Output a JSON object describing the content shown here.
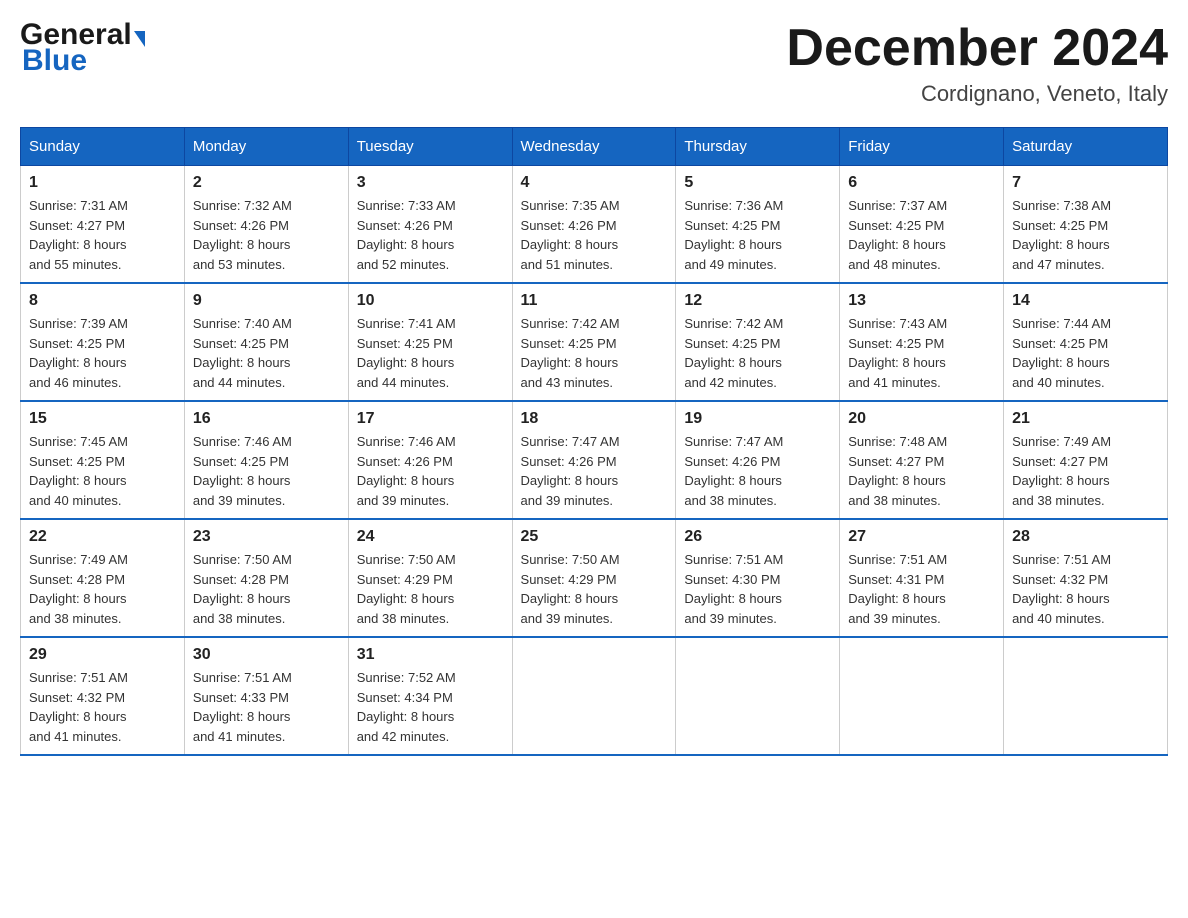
{
  "header": {
    "logo_general": "General",
    "logo_blue": "Blue",
    "month_title": "December 2024",
    "location": "Cordignano, Veneto, Italy"
  },
  "days_of_week": [
    "Sunday",
    "Monday",
    "Tuesday",
    "Wednesday",
    "Thursday",
    "Friday",
    "Saturday"
  ],
  "weeks": [
    [
      {
        "day": "1",
        "sunrise": "7:31 AM",
        "sunset": "4:27 PM",
        "daylight": "8 hours and 55 minutes."
      },
      {
        "day": "2",
        "sunrise": "7:32 AM",
        "sunset": "4:26 PM",
        "daylight": "8 hours and 53 minutes."
      },
      {
        "day": "3",
        "sunrise": "7:33 AM",
        "sunset": "4:26 PM",
        "daylight": "8 hours and 52 minutes."
      },
      {
        "day": "4",
        "sunrise": "7:35 AM",
        "sunset": "4:26 PM",
        "daylight": "8 hours and 51 minutes."
      },
      {
        "day": "5",
        "sunrise": "7:36 AM",
        "sunset": "4:25 PM",
        "daylight": "8 hours and 49 minutes."
      },
      {
        "day": "6",
        "sunrise": "7:37 AM",
        "sunset": "4:25 PM",
        "daylight": "8 hours and 48 minutes."
      },
      {
        "day": "7",
        "sunrise": "7:38 AM",
        "sunset": "4:25 PM",
        "daylight": "8 hours and 47 minutes."
      }
    ],
    [
      {
        "day": "8",
        "sunrise": "7:39 AM",
        "sunset": "4:25 PM",
        "daylight": "8 hours and 46 minutes."
      },
      {
        "day": "9",
        "sunrise": "7:40 AM",
        "sunset": "4:25 PM",
        "daylight": "8 hours and 44 minutes."
      },
      {
        "day": "10",
        "sunrise": "7:41 AM",
        "sunset": "4:25 PM",
        "daylight": "8 hours and 44 minutes."
      },
      {
        "day": "11",
        "sunrise": "7:42 AM",
        "sunset": "4:25 PM",
        "daylight": "8 hours and 43 minutes."
      },
      {
        "day": "12",
        "sunrise": "7:42 AM",
        "sunset": "4:25 PM",
        "daylight": "8 hours and 42 minutes."
      },
      {
        "day": "13",
        "sunrise": "7:43 AM",
        "sunset": "4:25 PM",
        "daylight": "8 hours and 41 minutes."
      },
      {
        "day": "14",
        "sunrise": "7:44 AM",
        "sunset": "4:25 PM",
        "daylight": "8 hours and 40 minutes."
      }
    ],
    [
      {
        "day": "15",
        "sunrise": "7:45 AM",
        "sunset": "4:25 PM",
        "daylight": "8 hours and 40 minutes."
      },
      {
        "day": "16",
        "sunrise": "7:46 AM",
        "sunset": "4:25 PM",
        "daylight": "8 hours and 39 minutes."
      },
      {
        "day": "17",
        "sunrise": "7:46 AM",
        "sunset": "4:26 PM",
        "daylight": "8 hours and 39 minutes."
      },
      {
        "day": "18",
        "sunrise": "7:47 AM",
        "sunset": "4:26 PM",
        "daylight": "8 hours and 39 minutes."
      },
      {
        "day": "19",
        "sunrise": "7:47 AM",
        "sunset": "4:26 PM",
        "daylight": "8 hours and 38 minutes."
      },
      {
        "day": "20",
        "sunrise": "7:48 AM",
        "sunset": "4:27 PM",
        "daylight": "8 hours and 38 minutes."
      },
      {
        "day": "21",
        "sunrise": "7:49 AM",
        "sunset": "4:27 PM",
        "daylight": "8 hours and 38 minutes."
      }
    ],
    [
      {
        "day": "22",
        "sunrise": "7:49 AM",
        "sunset": "4:28 PM",
        "daylight": "8 hours and 38 minutes."
      },
      {
        "day": "23",
        "sunrise": "7:50 AM",
        "sunset": "4:28 PM",
        "daylight": "8 hours and 38 minutes."
      },
      {
        "day": "24",
        "sunrise": "7:50 AM",
        "sunset": "4:29 PM",
        "daylight": "8 hours and 38 minutes."
      },
      {
        "day": "25",
        "sunrise": "7:50 AM",
        "sunset": "4:29 PM",
        "daylight": "8 hours and 39 minutes."
      },
      {
        "day": "26",
        "sunrise": "7:51 AM",
        "sunset": "4:30 PM",
        "daylight": "8 hours and 39 minutes."
      },
      {
        "day": "27",
        "sunrise": "7:51 AM",
        "sunset": "4:31 PM",
        "daylight": "8 hours and 39 minutes."
      },
      {
        "day": "28",
        "sunrise": "7:51 AM",
        "sunset": "4:32 PM",
        "daylight": "8 hours and 40 minutes."
      }
    ],
    [
      {
        "day": "29",
        "sunrise": "7:51 AM",
        "sunset": "4:32 PM",
        "daylight": "8 hours and 41 minutes."
      },
      {
        "day": "30",
        "sunrise": "7:51 AM",
        "sunset": "4:33 PM",
        "daylight": "8 hours and 41 minutes."
      },
      {
        "day": "31",
        "sunrise": "7:52 AM",
        "sunset": "4:34 PM",
        "daylight": "8 hours and 42 minutes."
      },
      null,
      null,
      null,
      null
    ]
  ]
}
